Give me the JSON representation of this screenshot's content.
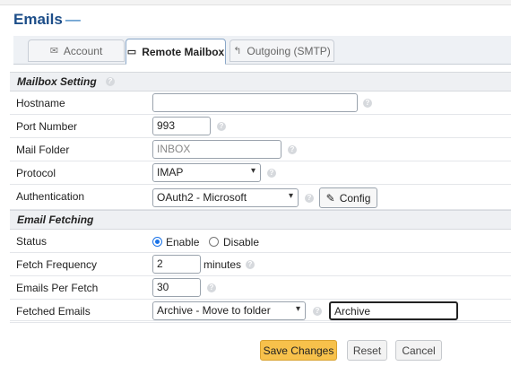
{
  "page": {
    "title": "Emails",
    "title_suffix": "—"
  },
  "tabs": [
    {
      "label": "Account",
      "icon": "envelope-icon",
      "active": false
    },
    {
      "label": "Remote Mailbox",
      "icon": "inbox-icon",
      "active": true
    },
    {
      "label": "Outgoing (SMTP)",
      "icon": "reply-icon",
      "active": false
    }
  ],
  "mailbox_section": {
    "title": "Mailbox Setting",
    "hostname": {
      "label": "Hostname",
      "value": ""
    },
    "port": {
      "label": "Port Number",
      "value": "993"
    },
    "folder": {
      "label": "Mail Folder",
      "placeholder": "INBOX"
    },
    "protocol": {
      "label": "Protocol",
      "value": "IMAP"
    },
    "auth": {
      "label": "Authentication",
      "value": "OAuth2 - Microsoft",
      "config_label": "Config"
    }
  },
  "fetching_section": {
    "title": "Email Fetching",
    "status": {
      "label": "Status",
      "options": [
        "Enable",
        "Disable"
      ],
      "selected": "Enable"
    },
    "frequency": {
      "label": "Fetch Frequency",
      "value": "2",
      "unit": "minutes"
    },
    "per_fetch": {
      "label": "Emails Per Fetch",
      "value": "30"
    },
    "fetched": {
      "label": "Fetched Emails",
      "action": "Archive - Move to folder",
      "folder_value": "Archive"
    }
  },
  "buttons": {
    "save": "Save Changes",
    "reset": "Reset",
    "cancel": "Cancel"
  },
  "colors": {
    "title": "#1d4e89",
    "accent": "#1a73e8",
    "save": "#f7c14b"
  }
}
